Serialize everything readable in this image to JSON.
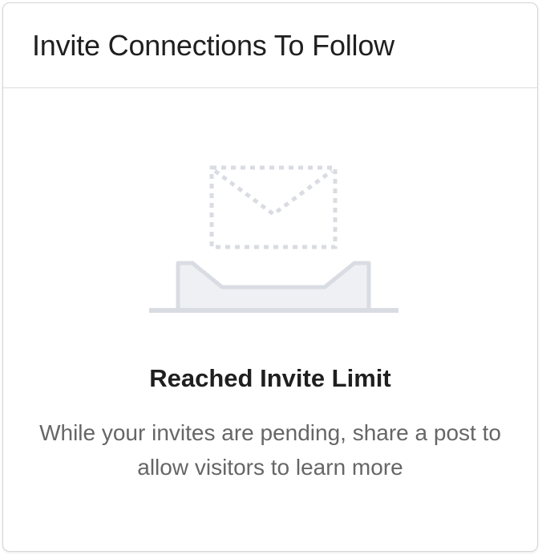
{
  "card": {
    "title": "Invite Connections To Follow"
  },
  "empty_state": {
    "illustration_icon": "envelope-into-tray-icon",
    "heading": "Reached Invite Limit",
    "message": "While your invites are pending, share a post to allow visitors to learn more"
  },
  "colors": {
    "title_text": "#1f1f1f",
    "body_text": "#666666",
    "illustration_gray": "#d9dce2",
    "divider": "#dcdcdc"
  }
}
